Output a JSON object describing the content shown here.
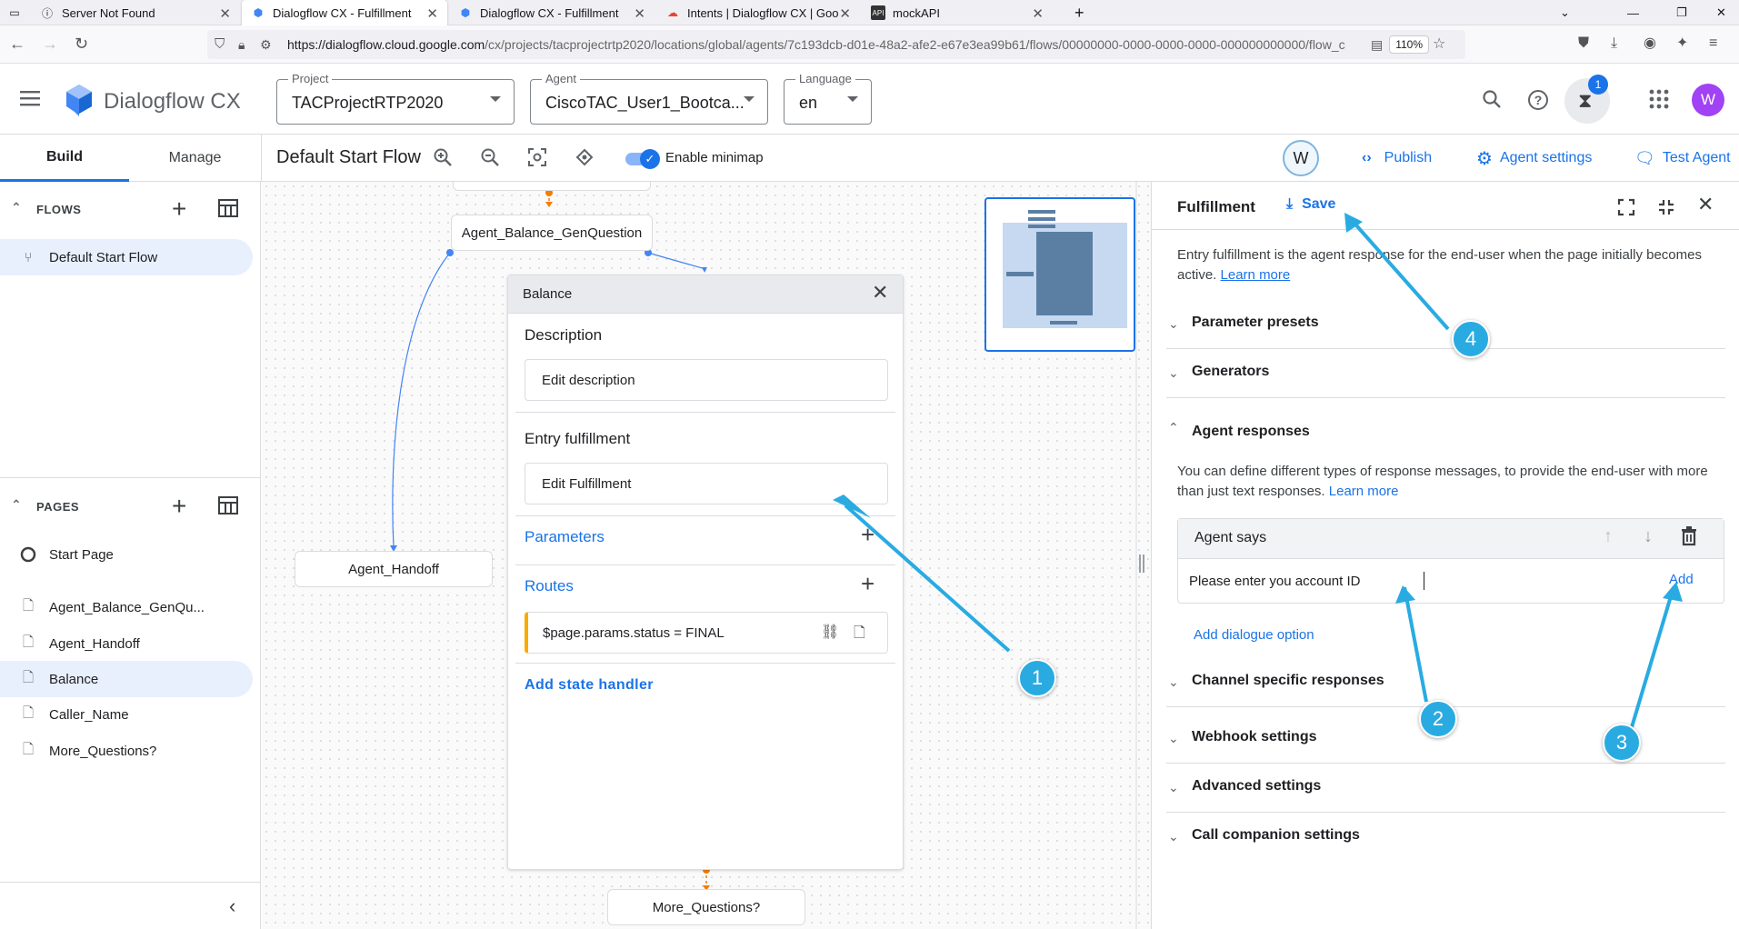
{
  "browser": {
    "tabs": [
      {
        "label": "Server Not Found",
        "icon": "info-icon"
      },
      {
        "label": "Dialogflow CX - Fulfillment",
        "icon": "dialogflow-icon"
      },
      {
        "label": "Dialogflow CX - Fulfillment",
        "icon": "dialogflow-icon"
      },
      {
        "label": "Intents | Dialogflow CX | Goo",
        "icon": "google-cloud-icon"
      },
      {
        "label": "mockAPI",
        "icon": "api-icon"
      }
    ],
    "url_host": "https://dialogflow.cloud.google.com",
    "url_path": "/cx/projects/tacprojectrtp2020/locations/global/agents/7c193dcb-d01e-48a2-afe2-e67e3ea99b61/flows/00000000-0000-0000-0000-000000000000/flow_c",
    "zoom": "110%"
  },
  "app": {
    "name": "Dialogflow CX",
    "project": {
      "label": "Project",
      "value": "TACProjectRTP2020"
    },
    "agent": {
      "label": "Agent",
      "value": "CiscoTAC_User1_Bootca..."
    },
    "language": {
      "label": "Language",
      "value": "en"
    },
    "notification_count": "1",
    "user_initial": "W"
  },
  "tabs": {
    "build": "Build",
    "manage": "Manage"
  },
  "toolbar": {
    "flow_title": "Default Start Flow",
    "minimap_label": "Enable minimap",
    "collaborator_initial": "W",
    "publish": "Publish",
    "agent_settings": "Agent settings",
    "test_agent": "Test Agent"
  },
  "sidebar": {
    "flows_header": "FLOWS",
    "flows": [
      "Default Start Flow"
    ],
    "pages_header": "PAGES",
    "pages": [
      "Start Page",
      "Agent_Balance_GenQu...",
      "Agent_Handoff",
      "Balance",
      "Caller_Name",
      "More_Questions?"
    ]
  },
  "canvas": {
    "nodes": {
      "gen_question": "Agent_Balance_GenQuestion",
      "handoff": "Agent_Handoff",
      "more_questions": "More_Questions?"
    },
    "card": {
      "title": "Balance",
      "description_header": "Description",
      "description_box": "Edit description",
      "entry_header": "Entry fulfillment",
      "entry_box": "Edit Fulfillment",
      "parameters": "Parameters",
      "routes": "Routes",
      "route_condition": "$page.params.status = FINAL",
      "add_state_handler": "Add state handler"
    }
  },
  "panel": {
    "title": "Fulfillment",
    "save": "Save",
    "intro": "Entry fulfillment is the agent response for the end-user when the page initially becomes active.",
    "learn_more": "Learn more",
    "sections": {
      "parameter_presets": "Parameter presets",
      "generators": "Generators",
      "agent_responses": "Agent responses",
      "channel_specific": "Channel specific responses",
      "webhook": "Webhook settings",
      "advanced": "Advanced settings",
      "call_companion": "Call companion settings"
    },
    "responses_text": "You can define different types of response messages, to provide the end-user with more than just text responses.",
    "agent_says_header": "Agent says",
    "agent_says_value": "Please enter you account ID",
    "add": "Add",
    "add_dialogue_option": "Add dialogue option"
  },
  "annotations": [
    "1",
    "2",
    "3",
    "4"
  ],
  "colors": {
    "accent": "#1a73e8",
    "callout": "#29abe2",
    "route_bar": "#f9ab00",
    "avatar": "#a142f4",
    "connector_orange": "#f57c00"
  }
}
